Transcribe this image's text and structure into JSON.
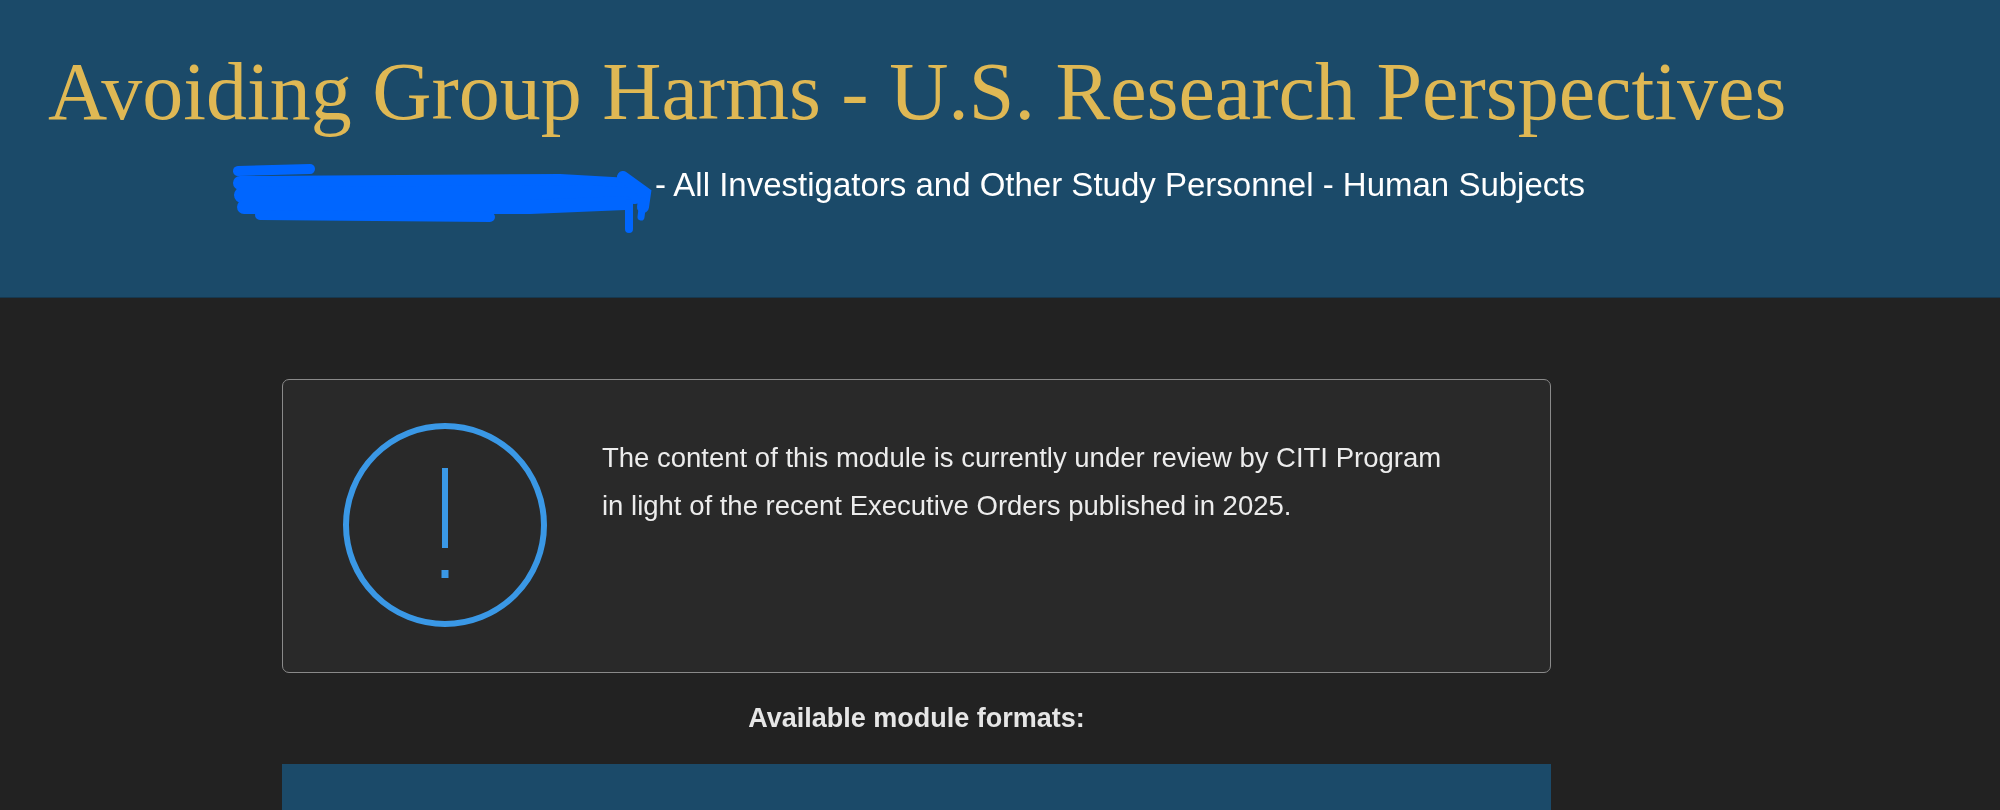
{
  "header": {
    "title": "Avoiding Group Harms - U.S. Research Perspectives",
    "redacted_prefix": true,
    "subtitle": "- All Investigators and Other Study Personnel - Human Subjects"
  },
  "notice": {
    "kind": "warning",
    "message": "The content of this module is currently under review by CITI Program in light of the recent Executive Orders published in 2025."
  },
  "formats": {
    "heading": "Available module formats:"
  }
}
